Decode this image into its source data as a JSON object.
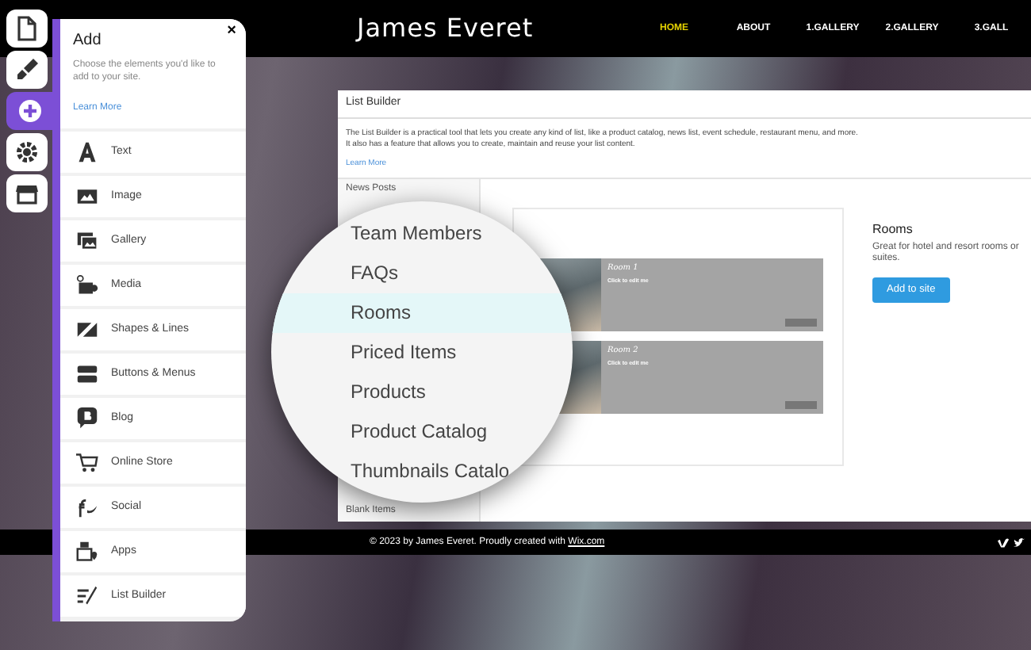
{
  "site": {
    "title": "James Everet",
    "nav": [
      {
        "label": "HOME",
        "selected": true
      },
      {
        "label": "ABOUT",
        "selected": false
      },
      {
        "label": "1.GALLERY",
        "selected": false
      },
      {
        "label": "2.GALLERY",
        "selected": false
      },
      {
        "label": "3.GALL",
        "selected": false
      }
    ],
    "footer": {
      "text": "© 2023 by James Everet. Proudly created with",
      "link": "Wix.com"
    }
  },
  "toolbar": [
    {
      "kind": "page",
      "selected": false
    },
    {
      "kind": "brush",
      "selected": false
    },
    {
      "kind": "add",
      "selected": true
    },
    {
      "kind": "settings",
      "selected": false
    },
    {
      "kind": "store",
      "selected": false
    }
  ],
  "add_panel": {
    "title": "Add",
    "close": "×",
    "description": "Choose the elements you'd like to add to your site.",
    "learn_more": "Learn More",
    "items": [
      {
        "label": "Text",
        "kind": "text"
      },
      {
        "label": "Image",
        "kind": "image"
      },
      {
        "label": "Gallery",
        "kind": "gallery"
      },
      {
        "label": "Media",
        "kind": "media"
      },
      {
        "label": "Shapes & Lines",
        "kind": "shapes"
      },
      {
        "label": "Buttons & Menus",
        "kind": "buttons"
      },
      {
        "label": "Blog",
        "kind": "blog"
      },
      {
        "label": "Online Store",
        "kind": "store"
      },
      {
        "label": "Social",
        "kind": "social"
      },
      {
        "label": "Apps",
        "kind": "apps"
      },
      {
        "label": "List Builder",
        "kind": "list"
      }
    ]
  },
  "list_builder": {
    "title": "List Builder",
    "description": [
      "The List Builder is a practical tool that lets you create any kind of list, like a product catalog, news list, event schedule, restaurant menu, and more.",
      "It also has a feature that allows you to create, maintain and reuse your list content."
    ],
    "learn_more": "Learn More",
    "list_column": [
      "News Posts",
      "Blank Items"
    ],
    "magnifier": [
      {
        "label": "Team Members",
        "selected": false
      },
      {
        "label": "FAQs",
        "selected": false
      },
      {
        "label": "Rooms",
        "selected": true
      },
      {
        "label": "Priced Items",
        "selected": false
      },
      {
        "label": "Products",
        "selected": false
      },
      {
        "label": "Product Catalog",
        "selected": false
      },
      {
        "label": "Thumbnails Catalo",
        "selected": false
      }
    ],
    "preview": [
      {
        "title": "Room 1",
        "subtitle": "Click to edit me"
      },
      {
        "title": "Room 2",
        "subtitle": "Click to edit me"
      }
    ],
    "detail": {
      "title": "Rooms",
      "description": "Great for hotel and resort rooms or suites.",
      "button": "Add to site"
    }
  }
}
